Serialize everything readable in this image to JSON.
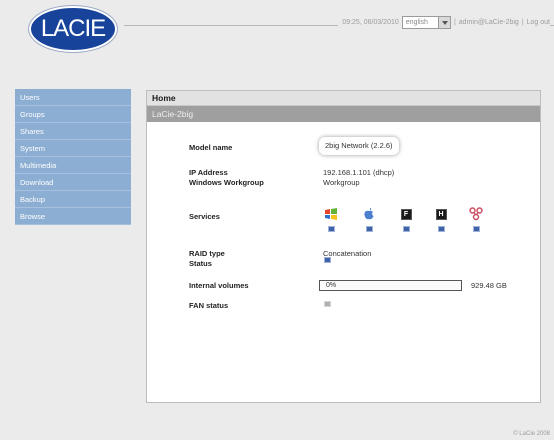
{
  "brand": {
    "logo_text": "LACIE",
    "color": "#17449a"
  },
  "topbar": {
    "datetime": "09:25, 06/03/2010",
    "language": "english",
    "sep1": "|",
    "user": "admin@LaCie-2big",
    "sep2": "|",
    "logout_label": "Log out"
  },
  "sidebar": {
    "items": [
      {
        "label": "Users"
      },
      {
        "label": "Groups"
      },
      {
        "label": "Shares"
      },
      {
        "label": "System"
      },
      {
        "label": "Multimedia"
      },
      {
        "label": "Download"
      },
      {
        "label": "Backup"
      },
      {
        "label": "Browse"
      }
    ]
  },
  "panel": {
    "breadcrumb": "Home",
    "section_title": "LaCie-2big",
    "model": {
      "label": "Model name",
      "value": "2big Network (2.2.6)"
    },
    "ip": {
      "label": "IP Address",
      "value": "192.168.1.101 (dhcp)"
    },
    "workgroup": {
      "label": "Windows Workgroup",
      "value": "Workgroup"
    },
    "services": {
      "label": "Services",
      "items": [
        {
          "icon": "windows-icon",
          "enabled": true
        },
        {
          "icon": "apple-icon",
          "enabled": true
        },
        {
          "icon": "ftp-icon",
          "letter": "F",
          "enabled": true
        },
        {
          "icon": "http-icon",
          "letter": "H",
          "enabled": true
        },
        {
          "icon": "upnp-icon",
          "enabled": true
        }
      ]
    },
    "raid": {
      "label": "RAID type",
      "value": "Concatenation"
    },
    "status": {
      "label": "Status"
    },
    "volumes": {
      "label": "Internal volumes",
      "percent_text": "0%",
      "used_fraction": 0.0,
      "size": "929.48 GB"
    },
    "fan": {
      "label": "FAN status"
    }
  },
  "footer": {
    "copyright": "© LaCie 2008"
  },
  "colors": {
    "sidebar": "#8daed3",
    "indicator": "#3f62a8"
  }
}
